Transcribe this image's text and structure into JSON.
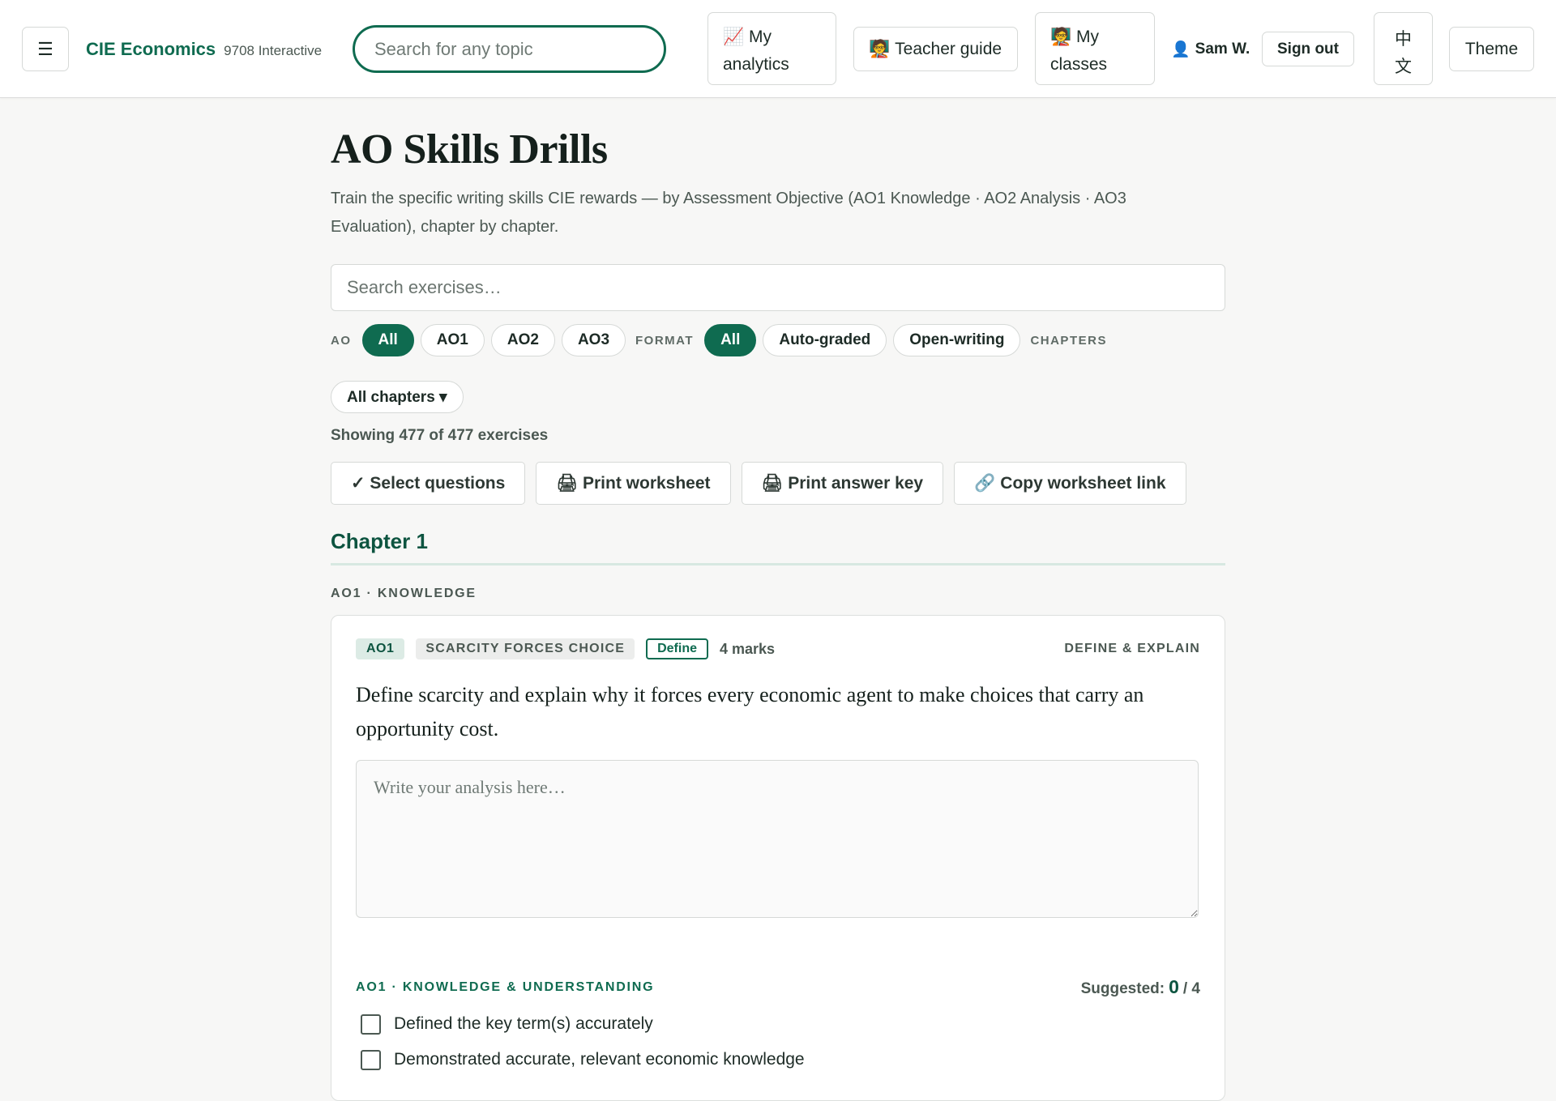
{
  "topbar": {
    "menu_icon": "☰",
    "brand_name": "CIE Economics",
    "brand_sub": "9708 Interactive",
    "search_placeholder": "Search for any topic",
    "nav": {
      "analytics_icon": "📈",
      "analytics_line1": "My",
      "analytics_line2": "analytics",
      "teacher_icon": "🧑‍🏫",
      "teacher_label": "Teacher guide",
      "classes_icon": "🧑‍🏫",
      "classes_line1": "My",
      "classes_line2": "classes"
    },
    "user_icon": "👤",
    "user_name": "Sam W.",
    "sign_out": "Sign out",
    "lang_line1": "中",
    "lang_line2": "文",
    "theme": "Theme"
  },
  "page": {
    "title": "AO Skills Drills",
    "subtitle": "Train the specific writing skills CIE rewards — by Assessment Objective (AO1 Knowledge · AO2 Analysis · AO3 Evaluation), chapter by chapter.",
    "search_placeholder": "Search exercises…",
    "filters": {
      "ao_label": "AO",
      "ao_options": [
        "All",
        "AO1",
        "AO2",
        "AO3"
      ],
      "ao_selected": "All",
      "format_label": "FORMAT",
      "format_options": [
        "All",
        "Auto-graded",
        "Open-writing"
      ],
      "format_selected": "All",
      "chapters_label": "CHAPTERS",
      "chapters_value": "All chapters ▾"
    },
    "count_text": "Showing 477 of 477 exercises",
    "actions": {
      "select": "✓ Select questions",
      "print_worksheet_icon": "🖨",
      "print_worksheet": "Print worksheet",
      "print_key_icon": "🖨",
      "print_key": "Print answer key",
      "copy_link_icon": "🔗",
      "copy_link": "Copy worksheet link"
    },
    "chapter_title": "Chapter 1",
    "section_label": "AO1 · KNOWLEDGE"
  },
  "exercise": {
    "ao_badge": "AO1",
    "topic_badge": "SCARCITY FORCES CHOICE",
    "type_badge": "Define",
    "marks": "4 marks",
    "skill": "DEFINE & EXPLAIN",
    "question": "Define scarcity and explain why it forces every economic agent to make choices that carry an opportunity cost.",
    "answer_placeholder": "Write your analysis here…",
    "rubric_title": "AO1 · KNOWLEDGE & UNDERSTANDING",
    "suggested_label": "Suggested:",
    "suggested_score": "0",
    "suggested_total": "/ 4",
    "criteria": [
      "Defined the key term(s) accurately",
      "Demonstrated accurate, relevant economic knowledge"
    ]
  },
  "colors": {
    "accent": "#0f6b50",
    "accent_dark": "#0d5440",
    "background": "#f7f7f6"
  }
}
